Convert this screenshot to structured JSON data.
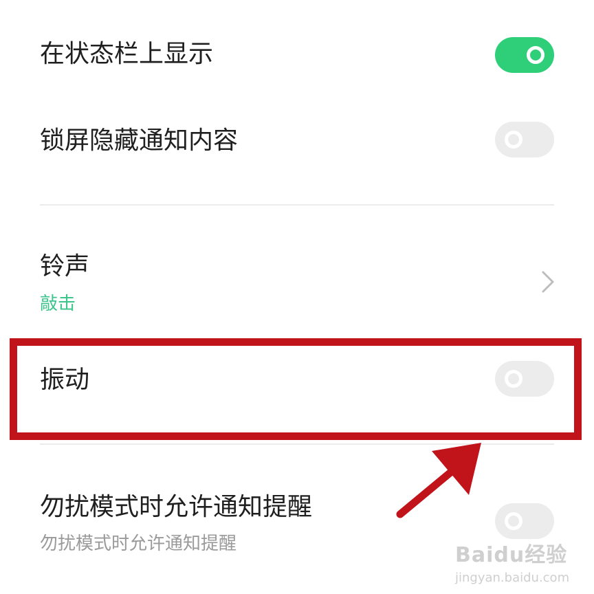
{
  "settings": {
    "status_bar": {
      "label": "在状态栏上显示",
      "enabled": true
    },
    "lock_screen_hide": {
      "label": "锁屏隐藏通知内容",
      "enabled": false
    },
    "ringtone": {
      "label": "铃声",
      "value": "敲击"
    },
    "vibration": {
      "label": "振动",
      "enabled": false
    },
    "dnd_allow": {
      "label": "勿扰模式时允许通知提醒",
      "description": "勿扰模式时允许通知提醒",
      "enabled": false
    }
  },
  "watermark": {
    "brand": "Baidu经验",
    "url": "jingyan.baidu.com"
  },
  "colors": {
    "accent": "#2fcf7a",
    "accent_text": "#3cc48b",
    "highlight": "#c0141a",
    "toggle_off": "#ececec"
  }
}
